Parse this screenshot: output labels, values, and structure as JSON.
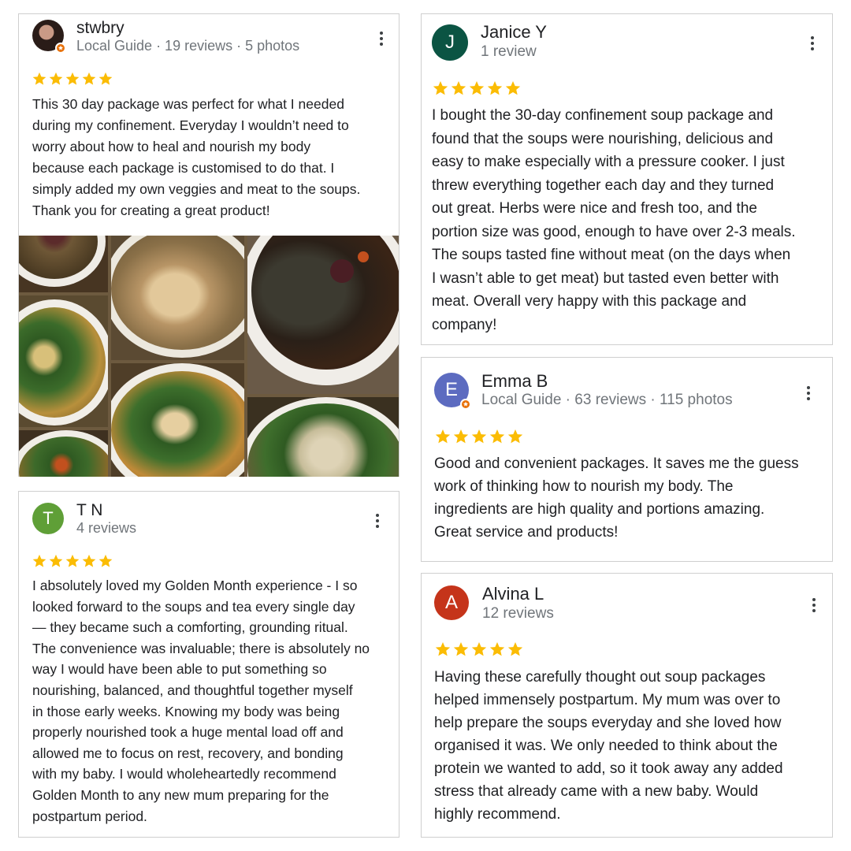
{
  "reviews": [
    {
      "name": "stwbry",
      "meta": "Local Guide · 19 reviews · 5 photos",
      "rating": 5,
      "text": "This 30 day package was perfect for what I needed\nduring my confinement. Everyday I wouldn’t need to\nworry about how to heal and nourish my body\nbecause each package is customised to do that. I\nsimply added my own veggies and meat to the soups.\nThank you for creating a great product!"
    },
    {
      "name": "T N",
      "avatar_letter": "T",
      "meta": "4 reviews",
      "rating": 5,
      "text": "I absolutely loved my Golden Month experience - I so\nlooked forward to the soups and tea every single day\n— they became such a comforting, grounding ritual.\nThe convenience was invaluable; there is absolutely no\nway I would have been able to put something so\nnourishing, balanced, and thoughtful together myself\nin those early weeks. Knowing my body was being\nproperly nourished took a huge mental load off and\nallowed me to focus on rest, recovery, and bonding\nwith my baby. I would wholeheartedly recommend\nGolden Month to any new mum preparing for the\npostpartum period."
    },
    {
      "name": "Janice Y",
      "avatar_letter": "J",
      "meta": "1 review",
      "rating": 5,
      "text": "I bought the 30-day confinement soup package and\nfound that the soups were nourishing, delicious and\neasy to make especially with a pressure cooker. I just\nthrew everything together each day and they turned\nout great. Herbs were nice and fresh too, and the\nportion size was good, enough to have over 2-3 meals.\nThe soups tasted fine without meat (on the days when\nI wasn’t able to get meat) but tasted even better with\nmeat. Overall very happy with this package and\ncompany!"
    },
    {
      "name": "Emma B",
      "avatar_letter": "E",
      "meta": "Local Guide · 63 reviews · 115 photos",
      "rating": 5,
      "text": "Good and convenient packages. It saves me the guess\nwork of thinking how to nourish my body. The\ningredients are high quality and portions amazing.\nGreat service and products!"
    },
    {
      "name": "Alvina L",
      "avatar_letter": "A",
      "meta": "12 reviews",
      "rating": 5,
      "text": "Having these carefully thought out soup packages\nhelped immensely postpartum. My mum was over to\nhelp prepare the soups everyday and she loved how\norganised it was. We only needed to think about the\nprotein we wanted to add, so it took away any added\nstress that already came with a new baby. Would\nhighly recommend."
    }
  ],
  "colors": {
    "star": "#fbbc04",
    "guide_badge": "#e8710a",
    "avatar_tn": "#5f9f37",
    "avatar_janice": "#0b5443",
    "avatar_emma": "#5c6bc0",
    "avatar_alvina": "#c5341a"
  }
}
